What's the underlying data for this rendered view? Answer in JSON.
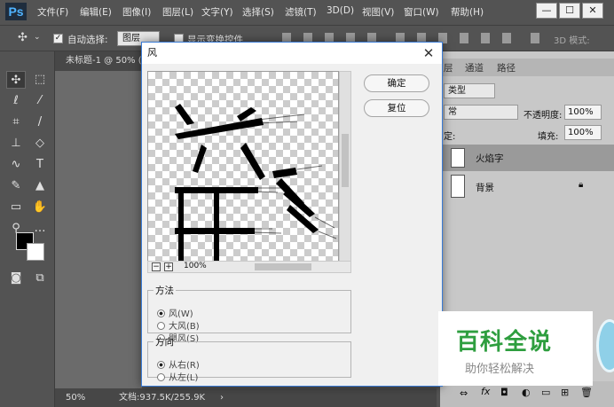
{
  "menubar": {
    "logo": "Ps",
    "items": [
      "文件(F)",
      "编辑(E)",
      "图像(I)",
      "图层(L)",
      "文字(Y)",
      "选择(S)",
      "滤镜(T)",
      "3D(D)",
      "视图(V)",
      "窗口(W)",
      "帮助(H)"
    ],
    "minimize": "—",
    "maximize": "☐",
    "close": "✕"
  },
  "options": {
    "auto_select_label": "自动选择:",
    "auto_select_value": "图层",
    "show_transform": "显示变换控件",
    "mode_3d": "3D 模式:"
  },
  "document": {
    "tab": "未标题-1 @ 50% (",
    "zoom": "50%",
    "docinfo": "文档:937.5K/255.9K",
    "arrow": "›"
  },
  "panel": {
    "tabs": [
      "层",
      "通道",
      "路径"
    ],
    "kind": "类型",
    "blend": "常",
    "opacity_label": "不透明度:",
    "opacity": "100%",
    "lock_label": "定:",
    "fill_label": "填充:",
    "fill": "100%",
    "layers": [
      {
        "name": "火焰字"
      },
      {
        "name": "背景"
      }
    ]
  },
  "dialog": {
    "title": "风",
    "close": "✕",
    "ok": "确定",
    "reset": "复位",
    "zoom": "100%",
    "method_legend": "方法",
    "methods": [
      "风(W)",
      "大风(B)",
      "飓风(S)"
    ],
    "direction_legend": "方向",
    "directions": [
      "从右(R)",
      "从左(L)"
    ]
  },
  "watermark": {
    "title": "百科全说",
    "subtitle": "助你轻松解决"
  },
  "colors": {
    "accent": "#3a7bd5",
    "watermark_green": "#2e9e3f"
  }
}
